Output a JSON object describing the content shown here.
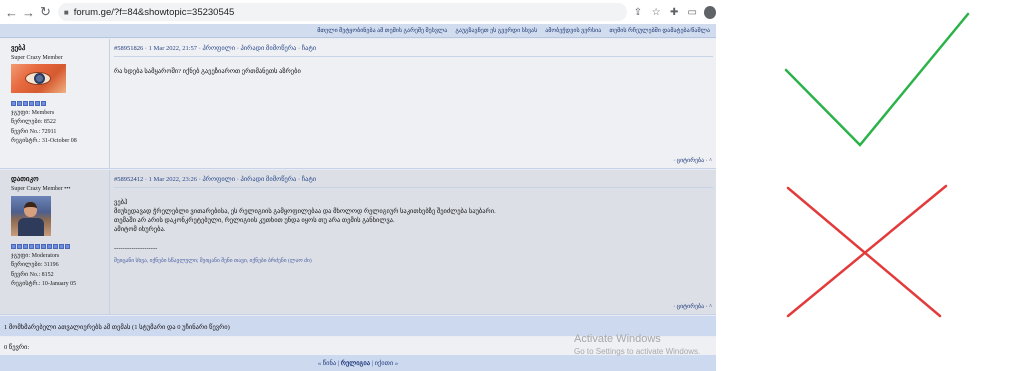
{
  "browser": {
    "url": "forum.ge/?f=84&showtopic=35230545"
  },
  "topbar": {
    "links": [
      "მთელი შეტყობინება ამ თემის გარეშე შესვლა",
      "გაუგზავნეთ ეს გვერდი სხვას",
      "ამობეჭდვის ვერსია",
      "თემის რჩეულებში დამატება/წაშლა"
    ]
  },
  "posts": [
    {
      "username": "ვებჰ",
      "title": "Super Crazy Member",
      "group": "ჯგუფი: Members",
      "posts_count": "წერილები: 8522",
      "member_no": "წევრი No.: 72911",
      "joined": "რეგისტრ.: 31-October 08",
      "header_link": "#58951826",
      "header_date": "· 1 Mar 2022, 21:57",
      "header_actions": "· პროფილი · პირადი მიმოწერა · ჩატი",
      "body": "რა ხდება სამყაროში? იქნებ გაეეზიაროთ ერთმანეთს აზრები",
      "footer": "· ციტირება · ^"
    },
    {
      "username": "დათიკო",
      "title": "Super Crazy Member •••",
      "group": "ჯგუფი: Moderators",
      "posts_count": "წერილები: 31196",
      "member_no": "წევრი No.: 8152",
      "joined": "რეგისტრ.: 10-January 05",
      "header_link": "#58952412",
      "header_date": "· 1 Mar 2022, 23:26",
      "header_actions": "· პროფილი · პირადი მიმოწერა · ჩატი",
      "body_lines": [
        "ვებჰ",
        "მიუხედავად ჭრელებლი ვითარებისა, ეს რელიგიის გამყოფილებაა და მხოლოდ რელიგიურ საკითხებზე შეიძლება საუბარი.",
        "თემაში არ არის დაკონკრეტებული, რელიგიის კუთხით უნდა იყოს თუ არა თემის განხილვა.",
        "ამიტომ იხურება."
      ],
      "divider": "--------------------",
      "signature": "შეიცანი სხვა, იქნები სწავლული; შეიცანი შენი თავი, იქნები ბრძენი (ლაო ძი)",
      "footer": "· ციტირება · ^"
    }
  ],
  "summary": "1 მომხმარებელი ათვალიერებს ამ თემას (1 სტუმარი და 0 უჩინარი წევრი)",
  "viewers": "0 წევრი:",
  "nav": {
    "prev": "« წინა",
    "separator1": " | ",
    "current": "რელიგია",
    "separator2": " | ",
    "next": "იქითი »"
  },
  "windows_watermark": {
    "title": "Activate Windows",
    "subtitle": "Go to Settings to activate Windows."
  },
  "colors": {
    "check": "#2bb34a",
    "cross": "#e33b3b",
    "forum_blue": "#1f3a7a"
  }
}
